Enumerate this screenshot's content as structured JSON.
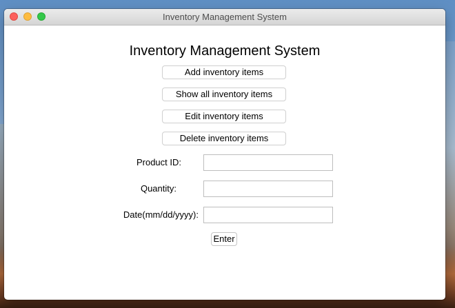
{
  "window": {
    "title": "Inventory Management System"
  },
  "main": {
    "heading": "Inventory Management System",
    "buttons": {
      "add": "Add inventory items",
      "show": "Show all inventory items",
      "edit": "Edit inventory items",
      "delete": "Delete inventory items"
    },
    "form": {
      "product_id_label": "Product ID:",
      "product_id_value": "",
      "quantity_label": "Quantity:",
      "quantity_value": "",
      "date_label": "Date(mm/dd/yyyy):",
      "date_value": "",
      "enter_label": "Enter"
    }
  }
}
